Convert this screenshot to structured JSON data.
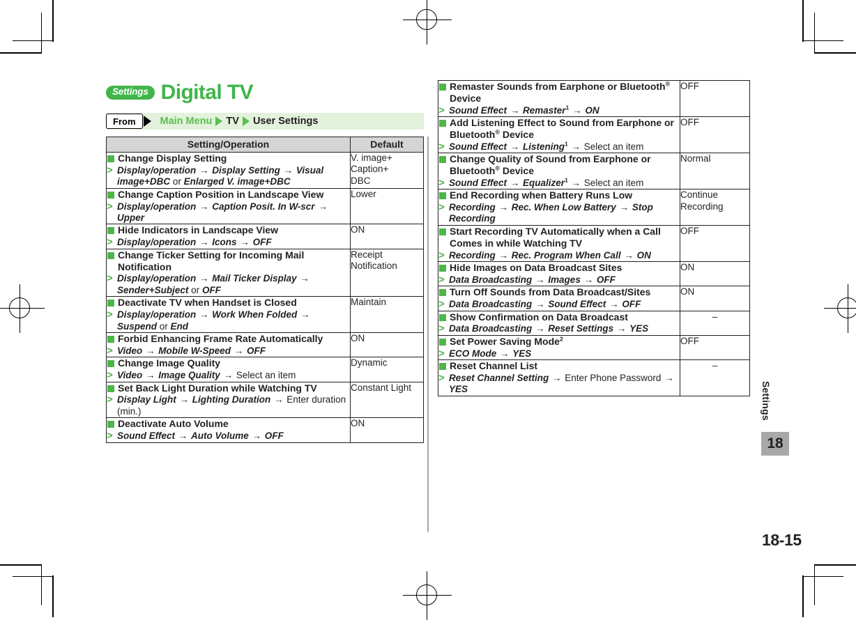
{
  "header": {
    "chip_label": "Settings",
    "title": "Digital TV"
  },
  "breadcrumb": {
    "from_label": "From",
    "crumb1": "Main Menu",
    "crumb2": "TV",
    "crumb3": "User Settings"
  },
  "table_headers": {
    "operation": "Setting/Operation",
    "default": "Default"
  },
  "left_table": {
    "rows": [
      {
        "title": "Change Display Setting",
        "path": [
          {
            "t": "Display/operation",
            "s": "bi"
          },
          {
            "t": " → ",
            "s": "arw"
          },
          {
            "t": "Display Setting",
            "s": "bi"
          },
          {
            "t": " → ",
            "s": "arw"
          },
          {
            "t": "Visual image+DBC",
            "s": "bi"
          },
          {
            "t": " or ",
            "s": "plain"
          },
          {
            "t": "Enlarged V. image+DBC",
            "s": "bi"
          }
        ],
        "default": "V. image+\nCaption+\nDBC",
        "default_align": "left"
      },
      {
        "title": "Change Caption Position in Landscape View",
        "path": [
          {
            "t": "Display/operation",
            "s": "bi"
          },
          {
            "t": " → ",
            "s": "arw"
          },
          {
            "t": "Caption Posit. In W-scr",
            "s": "bi"
          },
          {
            "t": " → ",
            "s": "arw"
          },
          {
            "t": "Upper",
            "s": "bi"
          }
        ],
        "default": "Lower",
        "default_align": "left"
      },
      {
        "title": "Hide Indicators in Landscape View",
        "path": [
          {
            "t": "Display/operation",
            "s": "bi"
          },
          {
            "t": " → ",
            "s": "arw"
          },
          {
            "t": "Icons",
            "s": "bi"
          },
          {
            "t": " → ",
            "s": "arw"
          },
          {
            "t": "OFF",
            "s": "bi"
          }
        ],
        "default": "ON",
        "default_align": "left"
      },
      {
        "title": "Change Ticker Setting for Incoming Mail Notification",
        "path": [
          {
            "t": "Display/operation",
            "s": "bi"
          },
          {
            "t": " → ",
            "s": "arw"
          },
          {
            "t": "Mail Ticker Display",
            "s": "bi"
          },
          {
            "t": " → ",
            "s": "arw"
          },
          {
            "t": "Sender+Subject",
            "s": "bi"
          },
          {
            "t": " or ",
            "s": "plain"
          },
          {
            "t": "OFF",
            "s": "bi"
          }
        ],
        "default": "Receipt\nNotification",
        "default_align": "left"
      },
      {
        "title": "Deactivate TV when Handset is Closed",
        "path": [
          {
            "t": "Display/operation",
            "s": "bi"
          },
          {
            "t": " → ",
            "s": "arw"
          },
          {
            "t": "Work When Folded",
            "s": "bi"
          },
          {
            "t": " → ",
            "s": "arw"
          },
          {
            "t": "Suspend",
            "s": "bi"
          },
          {
            "t": " or ",
            "s": "plain"
          },
          {
            "t": "End",
            "s": "bi"
          }
        ],
        "default": "Maintain",
        "default_align": "left"
      },
      {
        "title": "Forbid Enhancing Frame Rate Automatically",
        "path": [
          {
            "t": "Video",
            "s": "bi"
          },
          {
            "t": " → ",
            "s": "arw"
          },
          {
            "t": "Mobile W-Speed",
            "s": "bi"
          },
          {
            "t": " → ",
            "s": "arw"
          },
          {
            "t": "OFF",
            "s": "bi"
          }
        ],
        "default": "ON",
        "default_align": "left"
      },
      {
        "title": "Change Image Quality",
        "path": [
          {
            "t": "Video",
            "s": "bi"
          },
          {
            "t": " → ",
            "s": "arw"
          },
          {
            "t": "Image Quality",
            "s": "bi"
          },
          {
            "t": " → ",
            "s": "arw"
          },
          {
            "t": "Select an item",
            "s": "plain"
          }
        ],
        "default": "Dynamic",
        "default_align": "left"
      },
      {
        "title": "Set Back Light Duration while Watching TV",
        "path": [
          {
            "t": "Display Light",
            "s": "bi"
          },
          {
            "t": " → ",
            "s": "arw"
          },
          {
            "t": "Lighting Duration",
            "s": "bi"
          },
          {
            "t": " → ",
            "s": "arw"
          },
          {
            "t": "Enter duration (min.)",
            "s": "plain"
          }
        ],
        "default": "Constant Light",
        "default_align": "left"
      },
      {
        "title": "Deactivate Auto Volume",
        "path": [
          {
            "t": "Sound Effect",
            "s": "bi"
          },
          {
            "t": " → ",
            "s": "arw"
          },
          {
            "t": "Auto Volume",
            "s": "bi"
          },
          {
            "t": " → ",
            "s": "arw"
          },
          {
            "t": "OFF",
            "s": "bi"
          }
        ],
        "default": "ON",
        "default_align": "left"
      }
    ]
  },
  "right_table": {
    "rows": [
      {
        "title": "Remaster Sounds from Earphone or Bluetooth® Device",
        "path": [
          {
            "t": "Sound Effect",
            "s": "bi"
          },
          {
            "t": " → ",
            "s": "arw"
          },
          {
            "t": "Remaster",
            "s": "bi"
          },
          {
            "t": "1",
            "s": "sup"
          },
          {
            "t": " → ",
            "s": "arw"
          },
          {
            "t": "ON",
            "s": "bi"
          }
        ],
        "default": "OFF",
        "default_align": "left"
      },
      {
        "title": "Add Listening Effect to Sound from Earphone or Bluetooth® Device",
        "path": [
          {
            "t": "Sound Effect",
            "s": "bi"
          },
          {
            "t": " → ",
            "s": "arw"
          },
          {
            "t": "Listening",
            "s": "bi"
          },
          {
            "t": "1",
            "s": "sup"
          },
          {
            "t": " → ",
            "s": "arw"
          },
          {
            "t": "Select an item",
            "s": "plain"
          }
        ],
        "default": "OFF",
        "default_align": "left"
      },
      {
        "title": "Change Quality of Sound from Earphone or Bluetooth® Device",
        "path": [
          {
            "t": "Sound Effect",
            "s": "bi"
          },
          {
            "t": " → ",
            "s": "arw"
          },
          {
            "t": "Equalizer",
            "s": "bi"
          },
          {
            "t": "1",
            "s": "sup"
          },
          {
            "t": " → ",
            "s": "arw"
          },
          {
            "t": "Select an item",
            "s": "plain"
          }
        ],
        "default": "Normal",
        "default_align": "left"
      },
      {
        "title": "End Recording when Battery Runs Low",
        "path": [
          {
            "t": "Recording",
            "s": "bi"
          },
          {
            "t": " → ",
            "s": "arw"
          },
          {
            "t": "Rec. When Low Battery",
            "s": "bi"
          },
          {
            "t": " → ",
            "s": "arw"
          },
          {
            "t": "Stop Recording",
            "s": "bi"
          }
        ],
        "default": "Continue\nRecording",
        "default_align": "left"
      },
      {
        "title": "Start Recording TV Automatically when a Call Comes in while Watching TV",
        "path": [
          {
            "t": "Recording",
            "s": "bi"
          },
          {
            "t": " → ",
            "s": "arw"
          },
          {
            "t": "Rec. Program When Call",
            "s": "bi"
          },
          {
            "t": " → ",
            "s": "arw"
          },
          {
            "t": "ON",
            "s": "bi"
          }
        ],
        "default": "OFF",
        "default_align": "left"
      },
      {
        "title": "Hide Images on Data Broadcast Sites",
        "path": [
          {
            "t": "Data Broadcasting",
            "s": "bi"
          },
          {
            "t": " → ",
            "s": "arw"
          },
          {
            "t": "Images",
            "s": "bi"
          },
          {
            "t": " → ",
            "s": "arw"
          },
          {
            "t": "OFF",
            "s": "bi"
          }
        ],
        "default": "ON",
        "default_align": "left"
      },
      {
        "title": "Turn Off Sounds from Data Broadcast/Sites",
        "path": [
          {
            "t": "Data Broadcasting",
            "s": "bi"
          },
          {
            "t": " → ",
            "s": "arw"
          },
          {
            "t": "Sound Effect",
            "s": "bi"
          },
          {
            "t": " → ",
            "s": "arw"
          },
          {
            "t": "OFF",
            "s": "bi"
          }
        ],
        "default": "ON",
        "default_align": "left"
      },
      {
        "title": "Show Confirmation on Data Broadcast",
        "path": [
          {
            "t": "Data Broadcasting",
            "s": "bi"
          },
          {
            "t": " → ",
            "s": "arw"
          },
          {
            "t": "Reset Settings",
            "s": "bi"
          },
          {
            "t": " → ",
            "s": "arw"
          },
          {
            "t": "YES",
            "s": "bi"
          }
        ],
        "default": "–",
        "default_align": "center"
      },
      {
        "title": "Set Power Saving Mode",
        "title_sup": "2",
        "path": [
          {
            "t": "ECO Mode",
            "s": "bi"
          },
          {
            "t": " → ",
            "s": "arw"
          },
          {
            "t": "YES",
            "s": "bi"
          }
        ],
        "default": "OFF",
        "default_align": "left"
      },
      {
        "title": "Reset Channel List",
        "path": [
          {
            "t": "Reset Channel Setting",
            "s": "bi"
          },
          {
            "t": " → ",
            "s": "arw"
          },
          {
            "t": "Enter Phone Password",
            "s": "plain"
          },
          {
            "t": " → ",
            "s": "arw"
          },
          {
            "t": "YES",
            "s": "bi"
          }
        ],
        "default": "–",
        "default_align": "center"
      }
    ]
  },
  "sidebar": {
    "chapter_label": "Settings",
    "chapter_number": "18"
  },
  "footer": {
    "page_number": "18-15"
  },
  "colors": {
    "brand_green": "#3fb54a",
    "accent_green": "#4cb648",
    "crumb_band": "#e3f2dc",
    "table_header_gray": "#d5d5d5",
    "tab_gray": "#a8a8a8"
  }
}
